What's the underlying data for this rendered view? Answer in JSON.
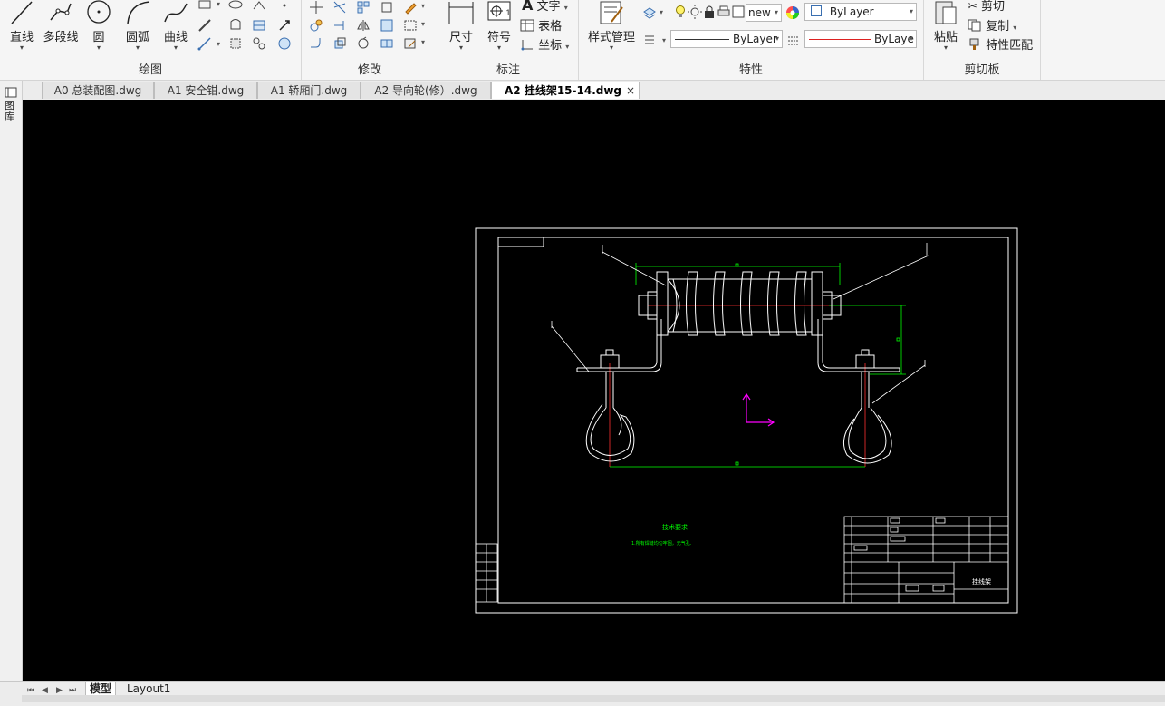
{
  "ribbon": {
    "draw": {
      "label": "绘图",
      "line": "直线",
      "polyline": "多段线",
      "circle": "圆",
      "arc": "圆弧",
      "curve": "曲线"
    },
    "modify": {
      "label": "修改"
    },
    "annotate": {
      "label": "标注",
      "dimension": "尺寸",
      "symbol": "符号",
      "text": "文字",
      "table": "表格",
      "coordinate": "坐标"
    },
    "properties": {
      "label": "特性",
      "style_manager": "样式管理",
      "layer_name": "new",
      "color": "ByLayer",
      "linetype": "ByLayer",
      "lineweight": "ByLaye"
    },
    "clipboard": {
      "label": "剪切板",
      "paste": "粘贴",
      "cut": "剪切",
      "copy": "复制",
      "match_properties": "特性匹配"
    }
  },
  "tabs": [
    {
      "label": "A0 总装配图.dwg",
      "active": false
    },
    {
      "label": "A1 安全钳.dwg",
      "active": false
    },
    {
      "label": "A1 轿厢门.dwg",
      "active": false
    },
    {
      "label": "A2 导向轮(修）.dwg",
      "active": false
    },
    {
      "label": "A2 挂线架15-14.dwg",
      "active": true
    }
  ],
  "tab_close": "×",
  "left_strip": {
    "label": "图库"
  },
  "drawing": {
    "accent_colors": {
      "geometry": "#ffffff",
      "dimension": "#00ff00",
      "centerline": "#ff0000",
      "ucs": "#ff00ff"
    },
    "notes_title": "技术要求",
    "notes_line": "1.所有焊缝均匀牢固，无气孔.",
    "title_block_name": "挂线架"
  },
  "layout_tabs": [
    {
      "label": "模型",
      "active": true
    },
    {
      "label": "Layout1",
      "active": false
    }
  ]
}
